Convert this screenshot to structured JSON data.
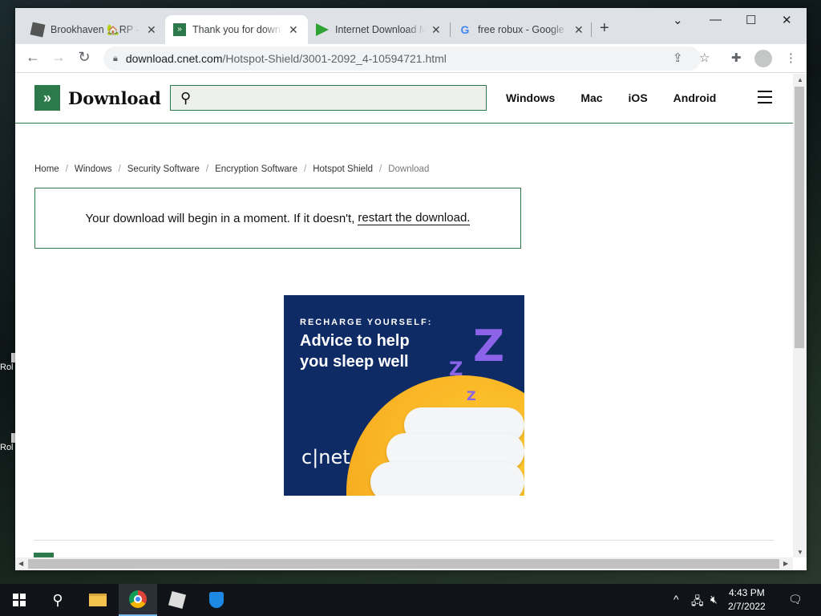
{
  "browser": {
    "tabs": [
      {
        "title": "Brookhaven 🏡RP - R",
        "icon": "roblox-favicon",
        "active": false
      },
      {
        "title": "Thank you for downloading",
        "icon": "cnet-download-favicon",
        "active": true
      },
      {
        "title": "Internet Download M",
        "icon": "idm-favicon",
        "active": false
      },
      {
        "title": "free robux - Google S",
        "icon": "google-favicon",
        "active": false
      }
    ],
    "url_host": "download.cnet.com",
    "url_path": "/Hotspot-Shield/3001-2092_4-10594721.html"
  },
  "site": {
    "logo_mark": "»",
    "logo_text": "Download",
    "search_placeholder": "",
    "nav": [
      "Windows",
      "Mac",
      "iOS",
      "Android"
    ]
  },
  "breadcrumb": [
    "Home",
    "Windows",
    "Security Software",
    "Encryption Software",
    "Hotspot Shield",
    "Download"
  ],
  "notice": {
    "text": "Your download will begin in a moment. If it doesn't,",
    "link": "restart the download."
  },
  "ad": {
    "kicker": "RECHARGE YOURSELF:",
    "headline": "Advice to help you sleep well",
    "brand": "c|net"
  },
  "desktop_labels": [
    "Rol",
    "Rol"
  ],
  "taskbar": {
    "time": "4:43 PM",
    "date": "2/7/2022"
  },
  "colors": {
    "brand_green": "#2c7a4b",
    "ad_navy": "#0f2b66",
    "ad_sun": "#f4a21a"
  }
}
